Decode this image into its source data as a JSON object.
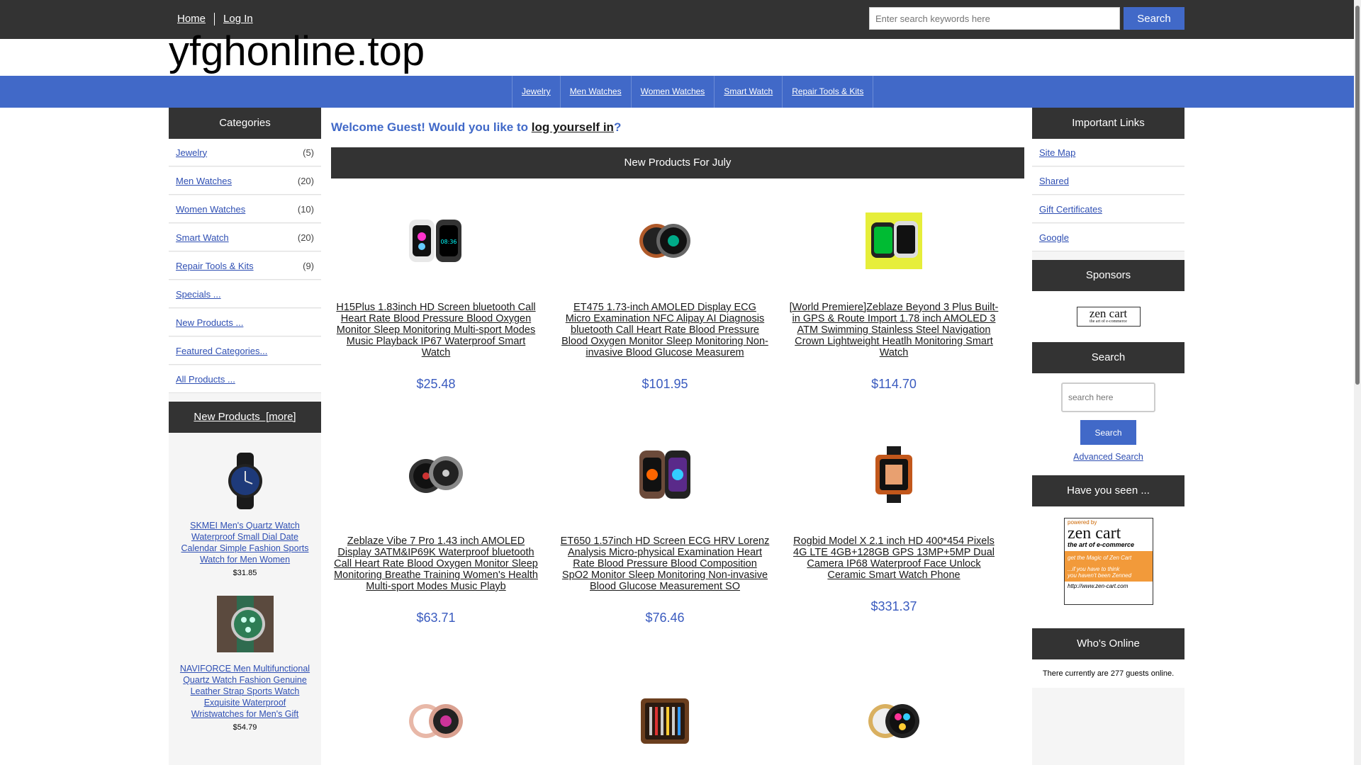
{
  "top_nav": {
    "home": "Home",
    "login": "Log In"
  },
  "top_search": {
    "placeholder": "Enter search keywords here",
    "button": "Search"
  },
  "logo": "yfghonline.top",
  "categories_nav": [
    "Jewelry",
    "Men Watches",
    "Women Watches",
    "Smart Watch",
    "Repair Tools & Kits"
  ],
  "left": {
    "categories_title": "Categories",
    "categories": [
      {
        "label": "Jewelry",
        "count": "(5)"
      },
      {
        "label": "Men Watches",
        "count": "(20)"
      },
      {
        "label": "Women Watches",
        "count": "(10)"
      },
      {
        "label": "Smart Watch",
        "count": "(20)"
      },
      {
        "label": "Repair Tools & Kits",
        "count": "(9)"
      }
    ],
    "extra_links": [
      "Specials ...",
      "New Products ...",
      "Featured Categories...",
      "All Products ..."
    ],
    "new_products_title": "New Products  [more]",
    "new_products": [
      {
        "name": "SKMEI Men's Quartz Watch Waterproof Small Dial Date Calendar Simple Fashion Sports Watch for Men Women",
        "price": "$31.85"
      },
      {
        "name": "NAVIFORCE Men Multifunctional Quartz Watch Fashion Genuine Leather Strap Sports Watch Exquisite Waterproof Wristwatches for Men's Gift",
        "price": "$54.79"
      }
    ]
  },
  "main": {
    "welcome_prefix": "Welcome Guest! Would you like to ",
    "welcome_link": "log yourself in",
    "welcome_suffix": "?",
    "new_products_title": "New Products For July",
    "products": [
      {
        "name": "H15Plus 1.83inch HD Screen bluetooth Call Heart Rate Blood Pressure Blood Oxygen Monitor Sleep Monitoring Multi-sport Modes Music Playback IP67 Waterproof Smart Watch",
        "price": "$25.48"
      },
      {
        "name": "ET475 1.73-inch AMOLED Display ECG Micro Examination NFC Alipay AI Diagnosis bluetooth Call Heart Rate Blood Pressure Blood Oxygen Monitor Sleep Monitoring Non-invasive Blood Glucose Measurem",
        "price": "$101.95"
      },
      {
        "name": "[World Premiere]Zeblaze Beyond 3 Plus Built-in GPS & Route Import 1.78 inch AMOLED 3 ATM Swimming Stainless Steel Navigation Crown Lightweight Heatlh Monitoring Smart Watch",
        "price": "$114.70"
      },
      {
        "name": "Zeblaze Vibe 7 Pro 1.43 inch AMOLED Display 3ATM&IP69K Waterproof bluetooth Call Heart Rate Blood Oxygen Monitor Sleep Monitoring Breathe Training Women's Health Multi-sport Modes Music Playb",
        "price": "$63.71"
      },
      {
        "name": "ET650 1.57inch HD Screen ECG HRV Lorenz Analysis Micro-physical Examination Heart Rate Blood Pressure Blood Composition SpO2 Monitor Sleep Monitoring Non-invasive Blood Glucose Measurement SO",
        "price": "$76.46"
      },
      {
        "name": "Rogbid Model X 2.1 inch HD 400*454 Pixels 4G LTE 4GB+128GB GPS 13MP+5MP Dual Camera IP68 Waterproof Face Unlock Ceramic Smart Watch Phone",
        "price": "$331.37"
      }
    ]
  },
  "right": {
    "important_links_title": "Important Links",
    "important_links": [
      "Site Map",
      "Shared",
      "Gift Certificates",
      "Google"
    ],
    "sponsors_title": "Sponsors",
    "sponsor_logo_text": "zen cart",
    "sponsor_logo_sub": "the art of e-commerce",
    "search_title": "Search",
    "search_placeholder": "search here",
    "search_button": "Search",
    "advanced_search": "Advanced Search",
    "have_you_seen_title": "Have you seen ...",
    "zen_badge": {
      "line1": "powered by",
      "line2": "zen cart",
      "line3": "the art of e-commerce",
      "line4": "get the Magic of Zen Cart",
      "line5": "...if you have to think",
      "line6": "you haven't been Zenned",
      "line7": "http://www.zen-cart.com"
    },
    "whos_online_title": "Who's Online",
    "whos_online_text": "There currently are 277 guests online."
  },
  "colors": {
    "dark": "#333333",
    "accent": "#4169c8",
    "link": "#2f4fb3"
  }
}
